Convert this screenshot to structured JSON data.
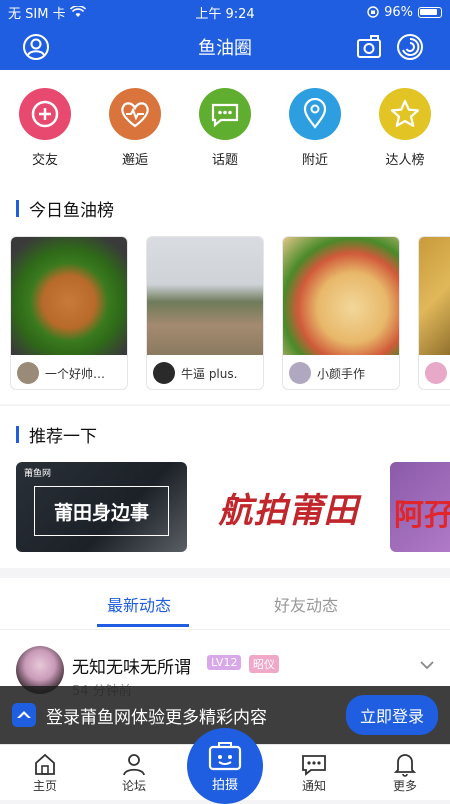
{
  "status": {
    "carrier": "无 SIM 卡",
    "time": "上午 9:24",
    "battery": "96%"
  },
  "header": {
    "title": "鱼油圈"
  },
  "categories": [
    {
      "label": "交友",
      "color": "#e84a6f",
      "icon": "plus-circle-icon"
    },
    {
      "label": "邂逅",
      "color": "#d9743c",
      "icon": "heartbeat-icon"
    },
    {
      "label": "话题",
      "color": "#5fae2f",
      "icon": "chat-bubble-icon"
    },
    {
      "label": "附近",
      "color": "#2d9fe0",
      "icon": "location-pin-icon"
    },
    {
      "label": "达人榜",
      "color": "#e2c525",
      "icon": "star-icon"
    }
  ],
  "today_ranking": {
    "title": "今日鱼油榜",
    "cards": [
      {
        "user": "一个好帅…"
      },
      {
        "user": "牛逼 plus."
      },
      {
        "user": "小颜手作"
      }
    ]
  },
  "recommend": {
    "title": "推荐一下",
    "banners": [
      {
        "logo": "莆鱼网",
        "text": "莆田身边事"
      },
      {
        "text": "航拍莆田"
      },
      {
        "text": "阿孖"
      }
    ]
  },
  "feed_tabs": {
    "latest": "最新动态",
    "friends": "好友动态"
  },
  "post": {
    "username": "无知无味无所谓",
    "level": "LV12",
    "badge": "昭仪",
    "time": "54 分钟前"
  },
  "login_banner": {
    "logo": "莆鱼网",
    "text": "登录莆鱼网体验更多精彩内容",
    "button": "立即登录"
  },
  "tabbar": {
    "home": "主页",
    "forum": "论坛",
    "capture": "拍摄",
    "notify": "通知",
    "more": "更多"
  }
}
